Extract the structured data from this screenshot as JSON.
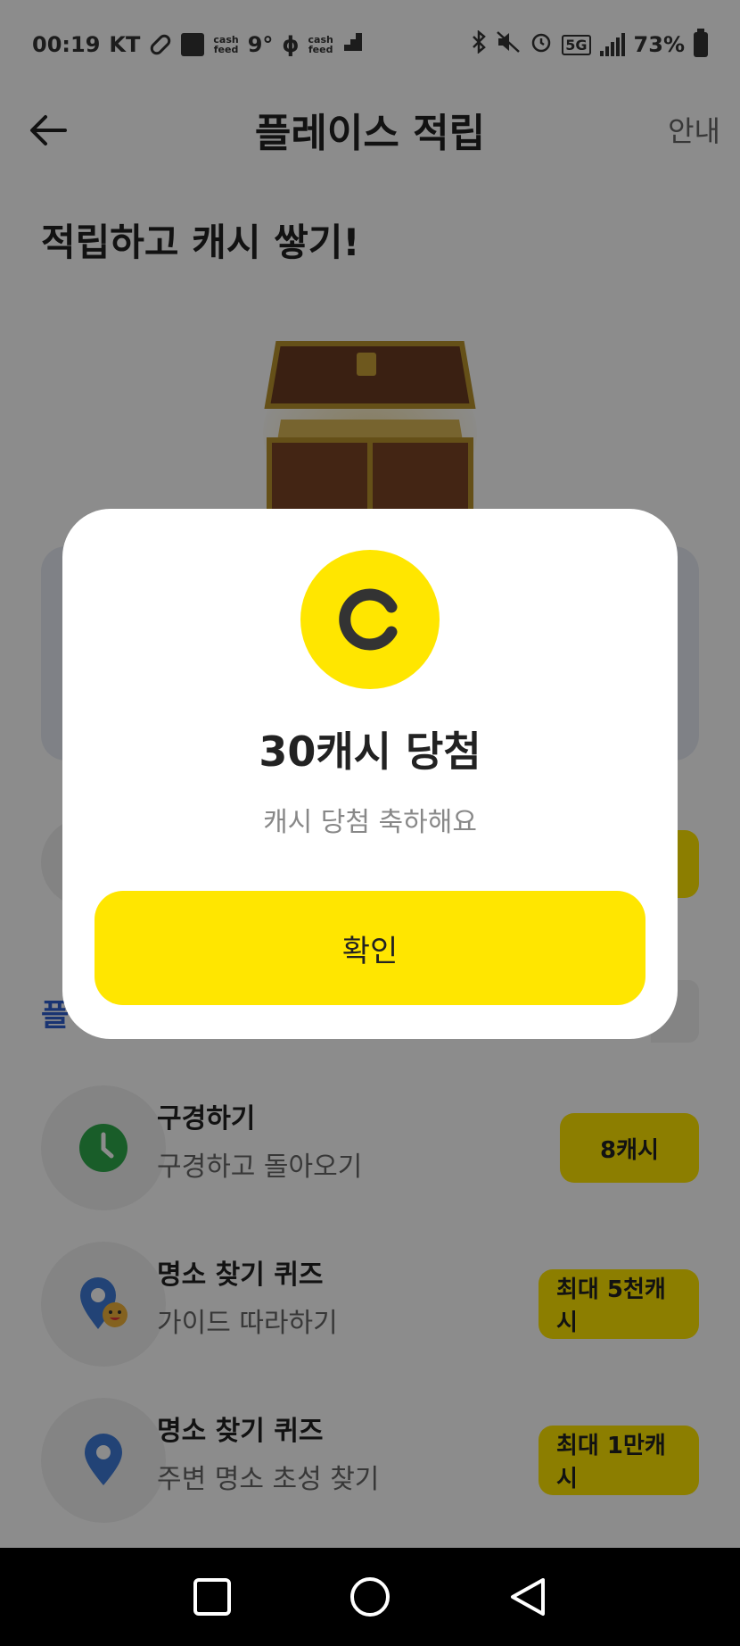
{
  "status_bar": {
    "time": "00:19",
    "carrier": "KT",
    "temp": "9°",
    "cashfeed_label": "cash\nfeed",
    "network": "5G",
    "battery": "73%"
  },
  "header": {
    "title": "플레이스 적립",
    "info": "안내"
  },
  "headline": "적립하고 캐시 쌓기!",
  "section_label": "플",
  "missions": [
    {
      "title": "구경하기",
      "subtitle": "구경하고 돌아오기",
      "reward": "8캐시",
      "icon": "clock-icon"
    },
    {
      "title": "명소 찾기 퀴즈",
      "subtitle": "가이드 따라하기",
      "reward": "최대 5천캐시",
      "icon": "map-pin-smiley-icon"
    },
    {
      "title": "명소 찾기 퀴즈",
      "subtitle": "주변 명소 초성 찾기",
      "reward": "최대 1만캐시",
      "icon": "map-pin-icon"
    }
  ],
  "dialog": {
    "coin_letter": "C",
    "title": "30캐시 당첨",
    "subtitle": "캐시 당첨 축하해요",
    "confirm": "확인"
  },
  "colors": {
    "accent": "#ffe600",
    "link_blue": "#2f5fd0",
    "overlay": "rgba(0,0,0,0.45)"
  }
}
